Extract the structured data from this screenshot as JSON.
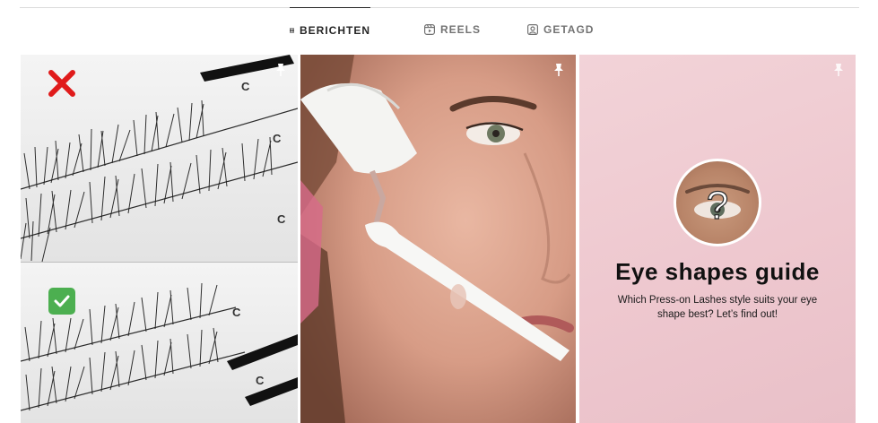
{
  "tabs": [
    {
      "label": "BERICHTEN",
      "icon": "grid-icon",
      "active": true
    },
    {
      "label": "REELS",
      "icon": "reels-icon",
      "active": false
    },
    {
      "label": "GETAGD",
      "icon": "tagged-icon",
      "active": false
    }
  ],
  "posts": [
    {
      "icon": "pin-icon",
      "pinned": true,
      "marks": [
        "cross-mark",
        "check-mark"
      ]
    },
    {
      "icon": "pin-icon",
      "pinned": true
    },
    {
      "icon": "pin-icon",
      "pinned": true,
      "badge_text": "?",
      "title": "Eye shapes guide",
      "subtitle": "Which Press-on Lashes style suits your eye shape best? Let’s find out!"
    }
  ],
  "colors": {
    "active_tab": "#262626",
    "inactive_tab": "#737373",
    "divider": "#dbdbdb",
    "cross_mark": "#e01b1b",
    "check_mark": "#4caf50",
    "guide_background": "#eec8cf"
  }
}
